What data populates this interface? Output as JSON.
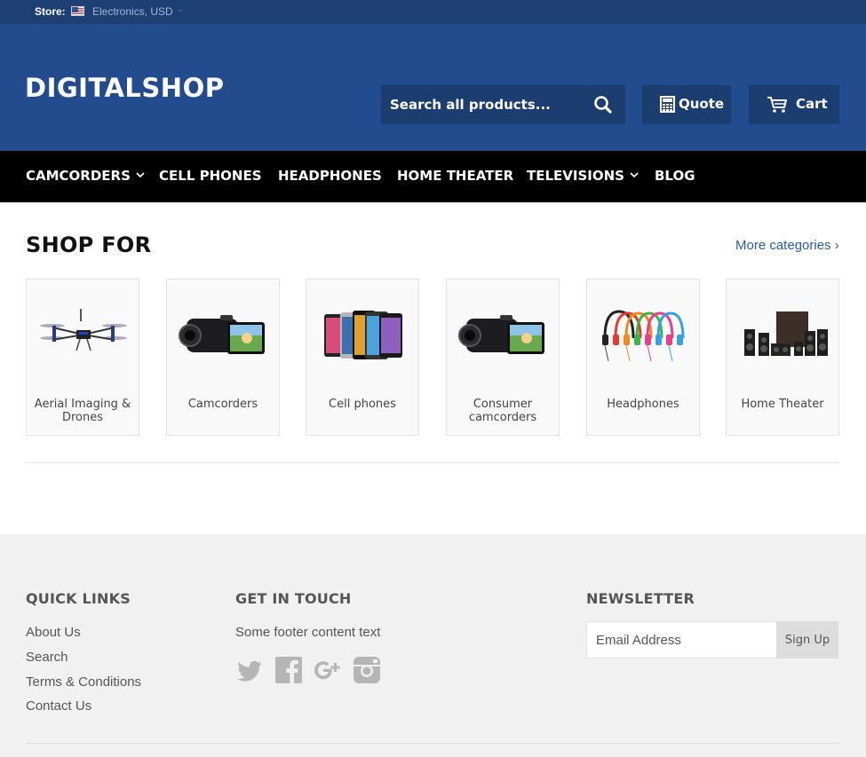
{
  "topbar": {
    "store_label": "Store:",
    "store_value": "Electronics, USD",
    "chevron": "⌄"
  },
  "header": {
    "logo": "DIGITALSHOP",
    "search_placeholder": "Search all products...",
    "quote_label": "Quote",
    "cart_label": "Cart"
  },
  "nav": {
    "items": [
      {
        "label": "CAMCORDERS",
        "has_dropdown": true
      },
      {
        "label": "CELL PHONES",
        "has_dropdown": false
      },
      {
        "label": "HEADPHONES",
        "has_dropdown": false
      },
      {
        "label": "HOME THEATER",
        "has_dropdown": false
      },
      {
        "label": "TELEVISIONS",
        "has_dropdown": true
      },
      {
        "label": "BLOG",
        "has_dropdown": false
      }
    ],
    "dropdown_icon": "chevron-down-icon"
  },
  "shop": {
    "title": "SHOP FOR",
    "more_link": "More categories ›",
    "categories": [
      {
        "label": "Aerial Imaging & Drones",
        "image": "drone"
      },
      {
        "label": "Camcorders",
        "image": "camcorder"
      },
      {
        "label": "Cell phones",
        "image": "phones"
      },
      {
        "label": "Consumer camcorders",
        "image": "camcorder"
      },
      {
        "label": "Headphones",
        "image": "headphones"
      },
      {
        "label": "Home Theater",
        "image": "speakers"
      }
    ]
  },
  "footer": {
    "quick_links_heading": "QUICK LINKS",
    "quick_links": [
      "About Us",
      "Search",
      "Terms & Conditions",
      "Contact Us"
    ],
    "contact_heading": "GET IN TOUCH",
    "contact_text": "Some footer content text",
    "social_icons": [
      "twitter-icon",
      "facebook-icon",
      "google-plus-icon",
      "instagram-icon"
    ],
    "newsletter_heading": "NEWSLETTER",
    "email_placeholder": "Email Address",
    "signup_label": "Sign Up"
  },
  "colors": {
    "topbar": "#1e3f74",
    "header": "#224c8d",
    "header_controls": "#1c3d70",
    "nav": "#000000",
    "link": "#2a5aa0",
    "footer": "#f1f1f1"
  }
}
